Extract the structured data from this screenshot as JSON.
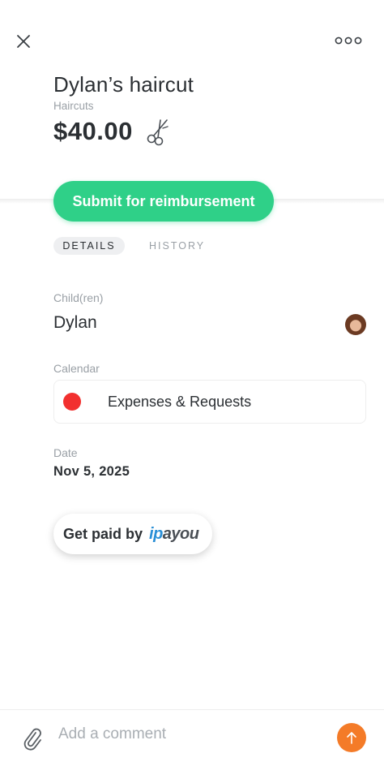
{
  "header": {
    "title": "Dylan’s haircut",
    "category": "Haircuts",
    "amount": "$40.00",
    "category_icon": "scissors-icon"
  },
  "actions": {
    "submit_label": "Submit for reimbursement",
    "close_icon": "close-icon",
    "more_icon": "more-options-icon"
  },
  "tabs": [
    {
      "label": "DETAILS",
      "active": true
    },
    {
      "label": "HISTORY",
      "active": false
    }
  ],
  "details": {
    "children_label": "Child(ren)",
    "children_value": "Dylan",
    "calendar_label": "Calendar",
    "calendar_value": "Expenses & Requests",
    "calendar_color": "#f2302f",
    "date_label": "Date",
    "date_value": "Nov 5, 2025"
  },
  "getpaid": {
    "label": "Get paid by",
    "brand_i": "i",
    "brand_p": "p",
    "brand_rest": "ayou"
  },
  "comment": {
    "placeholder": "Add a comment",
    "attach_icon": "paperclip-icon",
    "send_icon": "arrow-up-icon"
  },
  "colors": {
    "primary_green": "#2fd088",
    "send_orange": "#f47b28",
    "text": "#2b2f33",
    "muted": "#9aa0a6"
  }
}
